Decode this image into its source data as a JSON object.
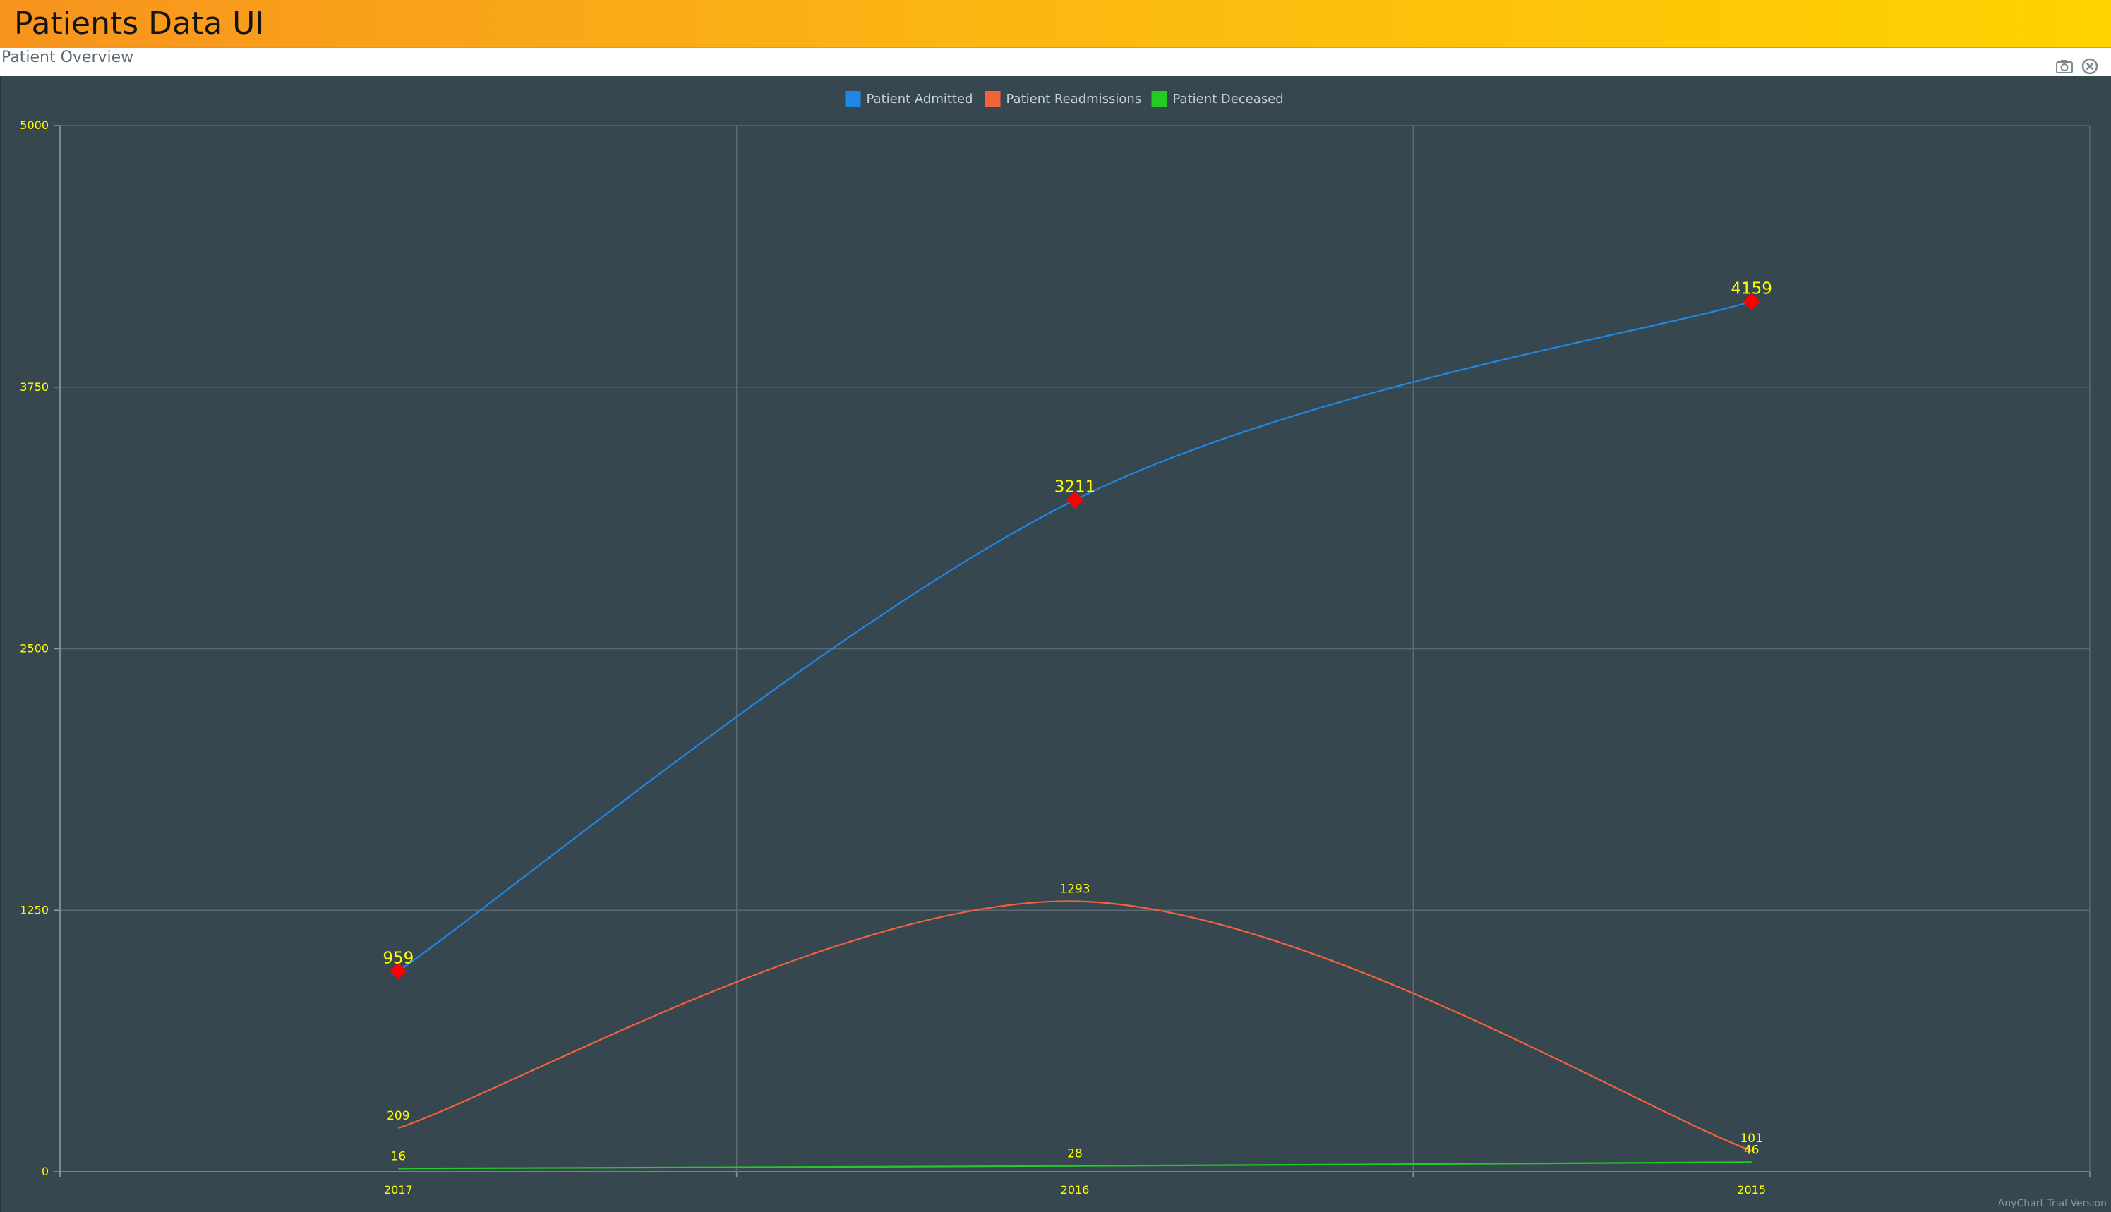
{
  "app": {
    "title": "Patients Data UI"
  },
  "panel": {
    "title": "Patient Overview",
    "buttons": [
      {
        "icon": "camera-icon"
      },
      {
        "icon": "close-icon"
      }
    ]
  },
  "credits": "AnyChart Trial Version",
  "colors": {
    "background": "#37474f",
    "grid": "#5b6a72",
    "label": "#ffff00",
    "marker": "#ff0000"
  },
  "chart_data": {
    "type": "line",
    "curve": "spline",
    "categories": [
      "2017",
      "2016",
      "2015"
    ],
    "ylim": [
      0,
      5000
    ],
    "yticks": [
      0,
      1250,
      2500,
      3750,
      5000
    ],
    "grid": true,
    "legend_position": "top-center",
    "series": [
      {
        "name": "Patient Admitted",
        "values": [
          959,
          3211,
          4159
        ],
        "color": "#1e88e5",
        "markers": true
      },
      {
        "name": "Patient Readmissions",
        "values": [
          209,
          1293,
          101
        ],
        "color": "#f4623a",
        "markers": false
      },
      {
        "name": "Patient Deceased",
        "values": [
          16,
          28,
          46
        ],
        "color": "#22cc22",
        "markers": false
      }
    ]
  }
}
